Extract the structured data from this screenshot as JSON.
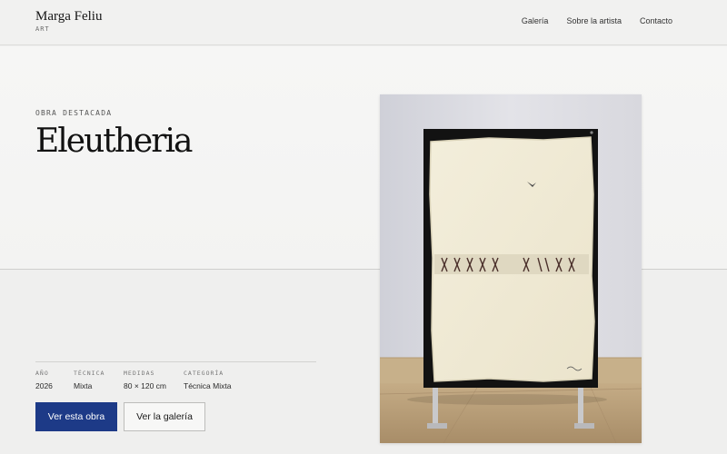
{
  "header": {
    "brand_name": "Marga Feliu",
    "brand_sub": "ART",
    "nav": [
      "Galería",
      "Sobre la artista",
      "Contacto"
    ]
  },
  "hero": {
    "eyebrow": "OBRA DESTACADA",
    "title": "Eleutheria",
    "meta": [
      {
        "label": "AÑO",
        "value": "2026"
      },
      {
        "label": "TÉCNICA",
        "value": "Mixta"
      },
      {
        "label": "MEDIDAS",
        "value": "80 × 120 cm"
      },
      {
        "label": "CATEGORÍA",
        "value": "Técnica Mixta"
      }
    ],
    "primary_button": "Ver esta obra",
    "secondary_button": "Ver la galería"
  },
  "colors": {
    "accent": "#1d3a87",
    "background": "#efefee"
  }
}
